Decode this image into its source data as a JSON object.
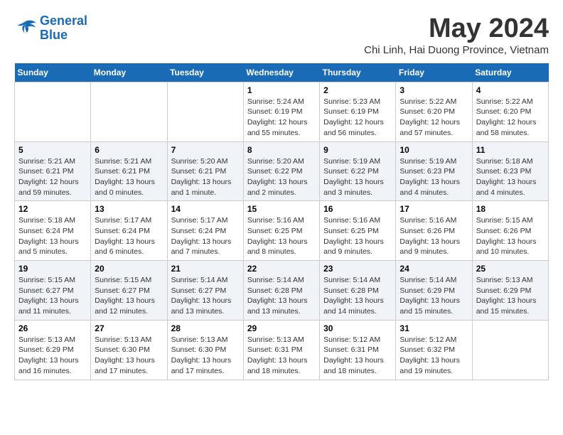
{
  "header": {
    "logo_line1": "General",
    "logo_line2": "Blue",
    "month_year": "May 2024",
    "location": "Chi Linh, Hai Duong Province, Vietnam"
  },
  "days_of_week": [
    "Sunday",
    "Monday",
    "Tuesday",
    "Wednesday",
    "Thursday",
    "Friday",
    "Saturday"
  ],
  "weeks": [
    [
      {
        "day": "",
        "info": ""
      },
      {
        "day": "",
        "info": ""
      },
      {
        "day": "",
        "info": ""
      },
      {
        "day": "1",
        "info": "Sunrise: 5:24 AM\nSunset: 6:19 PM\nDaylight: 12 hours\nand 55 minutes."
      },
      {
        "day": "2",
        "info": "Sunrise: 5:23 AM\nSunset: 6:19 PM\nDaylight: 12 hours\nand 56 minutes."
      },
      {
        "day": "3",
        "info": "Sunrise: 5:22 AM\nSunset: 6:20 PM\nDaylight: 12 hours\nand 57 minutes."
      },
      {
        "day": "4",
        "info": "Sunrise: 5:22 AM\nSunset: 6:20 PM\nDaylight: 12 hours\nand 58 minutes."
      }
    ],
    [
      {
        "day": "5",
        "info": "Sunrise: 5:21 AM\nSunset: 6:21 PM\nDaylight: 12 hours\nand 59 minutes."
      },
      {
        "day": "6",
        "info": "Sunrise: 5:21 AM\nSunset: 6:21 PM\nDaylight: 13 hours\nand 0 minutes."
      },
      {
        "day": "7",
        "info": "Sunrise: 5:20 AM\nSunset: 6:21 PM\nDaylight: 13 hours\nand 1 minute."
      },
      {
        "day": "8",
        "info": "Sunrise: 5:20 AM\nSunset: 6:22 PM\nDaylight: 13 hours\nand 2 minutes."
      },
      {
        "day": "9",
        "info": "Sunrise: 5:19 AM\nSunset: 6:22 PM\nDaylight: 13 hours\nand 3 minutes."
      },
      {
        "day": "10",
        "info": "Sunrise: 5:19 AM\nSunset: 6:23 PM\nDaylight: 13 hours\nand 4 minutes."
      },
      {
        "day": "11",
        "info": "Sunrise: 5:18 AM\nSunset: 6:23 PM\nDaylight: 13 hours\nand 4 minutes."
      }
    ],
    [
      {
        "day": "12",
        "info": "Sunrise: 5:18 AM\nSunset: 6:24 PM\nDaylight: 13 hours\nand 5 minutes."
      },
      {
        "day": "13",
        "info": "Sunrise: 5:17 AM\nSunset: 6:24 PM\nDaylight: 13 hours\nand 6 minutes."
      },
      {
        "day": "14",
        "info": "Sunrise: 5:17 AM\nSunset: 6:24 PM\nDaylight: 13 hours\nand 7 minutes."
      },
      {
        "day": "15",
        "info": "Sunrise: 5:16 AM\nSunset: 6:25 PM\nDaylight: 13 hours\nand 8 minutes."
      },
      {
        "day": "16",
        "info": "Sunrise: 5:16 AM\nSunset: 6:25 PM\nDaylight: 13 hours\nand 9 minutes."
      },
      {
        "day": "17",
        "info": "Sunrise: 5:16 AM\nSunset: 6:26 PM\nDaylight: 13 hours\nand 9 minutes."
      },
      {
        "day": "18",
        "info": "Sunrise: 5:15 AM\nSunset: 6:26 PM\nDaylight: 13 hours\nand 10 minutes."
      }
    ],
    [
      {
        "day": "19",
        "info": "Sunrise: 5:15 AM\nSunset: 6:27 PM\nDaylight: 13 hours\nand 11 minutes."
      },
      {
        "day": "20",
        "info": "Sunrise: 5:15 AM\nSunset: 6:27 PM\nDaylight: 13 hours\nand 12 minutes."
      },
      {
        "day": "21",
        "info": "Sunrise: 5:14 AM\nSunset: 6:27 PM\nDaylight: 13 hours\nand 13 minutes."
      },
      {
        "day": "22",
        "info": "Sunrise: 5:14 AM\nSunset: 6:28 PM\nDaylight: 13 hours\nand 13 minutes."
      },
      {
        "day": "23",
        "info": "Sunrise: 5:14 AM\nSunset: 6:28 PM\nDaylight: 13 hours\nand 14 minutes."
      },
      {
        "day": "24",
        "info": "Sunrise: 5:14 AM\nSunset: 6:29 PM\nDaylight: 13 hours\nand 15 minutes."
      },
      {
        "day": "25",
        "info": "Sunrise: 5:13 AM\nSunset: 6:29 PM\nDaylight: 13 hours\nand 15 minutes."
      }
    ],
    [
      {
        "day": "26",
        "info": "Sunrise: 5:13 AM\nSunset: 6:29 PM\nDaylight: 13 hours\nand 16 minutes."
      },
      {
        "day": "27",
        "info": "Sunrise: 5:13 AM\nSunset: 6:30 PM\nDaylight: 13 hours\nand 17 minutes."
      },
      {
        "day": "28",
        "info": "Sunrise: 5:13 AM\nSunset: 6:30 PM\nDaylight: 13 hours\nand 17 minutes."
      },
      {
        "day": "29",
        "info": "Sunrise: 5:13 AM\nSunset: 6:31 PM\nDaylight: 13 hours\nand 18 minutes."
      },
      {
        "day": "30",
        "info": "Sunrise: 5:12 AM\nSunset: 6:31 PM\nDaylight: 13 hours\nand 18 minutes."
      },
      {
        "day": "31",
        "info": "Sunrise: 5:12 AM\nSunset: 6:32 PM\nDaylight: 13 hours\nand 19 minutes."
      },
      {
        "day": "",
        "info": ""
      }
    ]
  ]
}
